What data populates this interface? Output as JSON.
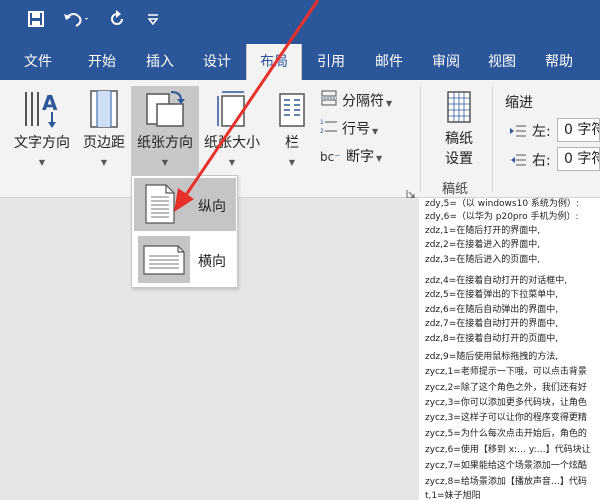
{
  "theme": {
    "accent": "#2b579a",
    "ribbon_bg": "#f3f3f3",
    "arrow_color": "#e8302a"
  },
  "quick_access": {
    "save_icon": "save-icon",
    "undo_icon": "undo-icon",
    "redo_icon": "redo-icon",
    "customize_icon": "customize-dropdown-icon"
  },
  "tabs": [
    {
      "label": "文件"
    },
    {
      "label": "开始"
    },
    {
      "label": "插入"
    },
    {
      "label": "设计"
    },
    {
      "label": "布局",
      "active": true
    },
    {
      "label": "引用"
    },
    {
      "label": "邮件"
    },
    {
      "label": "审阅"
    },
    {
      "label": "视图"
    },
    {
      "label": "帮助"
    }
  ],
  "ribbon": {
    "text_direction": "文字方向",
    "margins": "页边距",
    "orientation": "纸张方向",
    "size": "纸张大小",
    "columns": "栏",
    "breaks": "分隔符",
    "line_numbers": "行号",
    "hyphenation": "断字",
    "manuscript_settings_line1": "稿纸",
    "manuscript_settings_line2": "设置",
    "manuscript_group": "稿纸",
    "indent_title": "缩进",
    "indent_left_label": "左:",
    "indent_left_value": "0 字符",
    "indent_right_label": "右:",
    "indent_right_value": "0 字符"
  },
  "orientation_menu": {
    "portrait": "纵向",
    "landscape": "横向"
  },
  "document_lines": [
    "zdy,5=（以 windows10 系统为例）:",
    "zdy,6=（以华为 p20pro 手机为例）:",
    "zdz,1=在随后打开的界面中,",
    "zdz,2=在接着进入的界面中,",
    "zdz,3=在随后进入的页面中,",
    "zdz,4=在接着自动打开的对话框中,",
    "zdz,5=在接着弹出的下拉菜单中,",
    "zdz,6=在随后自动弹出的界面中,",
    "zdz,7=在接着自动打开的界面中,",
    "zdz,8=在接着自动打开的页面中,",
    "zdz,9=随后使用鼠标拖拽的方法,",
    "zycz,1=老师提示一下哦，可以点击背景",
    "zycz,2=除了这个角色之外，我们还有好",
    "zycz,3=你可以添加更多代码块，让角色",
    "zycz,3=这样子可以让你的程序变得更精",
    "zycz,5=为什么每次点击开始后，角色的",
    "zycz,6=使用【移到 x:… y:…】代码块让",
    "zycz,7=如果能给这个场景添加一个炫酷",
    "zycz,8=给场景添加【播放声音…】代码",
    "t,1=妹子旭阳"
  ]
}
